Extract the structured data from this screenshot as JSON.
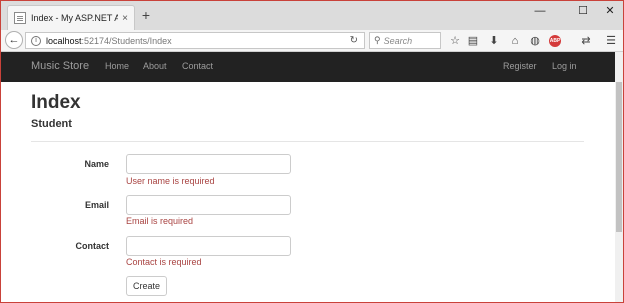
{
  "browser": {
    "tab_title": "Index - My ASP.NET Applica",
    "tab_close": "×",
    "new_tab": "+",
    "window_controls": {
      "minimize": "—",
      "maximize": "☐",
      "close": "✕"
    },
    "url_host": "localhost",
    "url_rest": ":52174/Students/Index",
    "search_placeholder": "Search",
    "icons": [
      "star-icon",
      "reader-icon",
      "download-icon",
      "home-icon",
      "pocket-icon",
      "adblock-icon",
      "extensions-icon",
      "menu-icon"
    ],
    "adblock_label": "ABP"
  },
  "navbar": {
    "brand": "Music Store",
    "links": [
      "Home",
      "About",
      "Contact"
    ],
    "right_links": [
      "Register",
      "Log in"
    ]
  },
  "page": {
    "title": "Index",
    "subtitle": "Student"
  },
  "form": {
    "fields": [
      {
        "label": "Name",
        "value": "",
        "error": "User name is required"
      },
      {
        "label": "Email",
        "value": "",
        "error": "Email is required"
      },
      {
        "label": "Contact",
        "value": "",
        "error": "Contact is required"
      }
    ],
    "submit_label": "Create"
  },
  "colors": {
    "navbar_bg": "#222222",
    "navbar_text": "#9d9d9d",
    "error": "#a94442",
    "window_border": "#c9423a"
  }
}
